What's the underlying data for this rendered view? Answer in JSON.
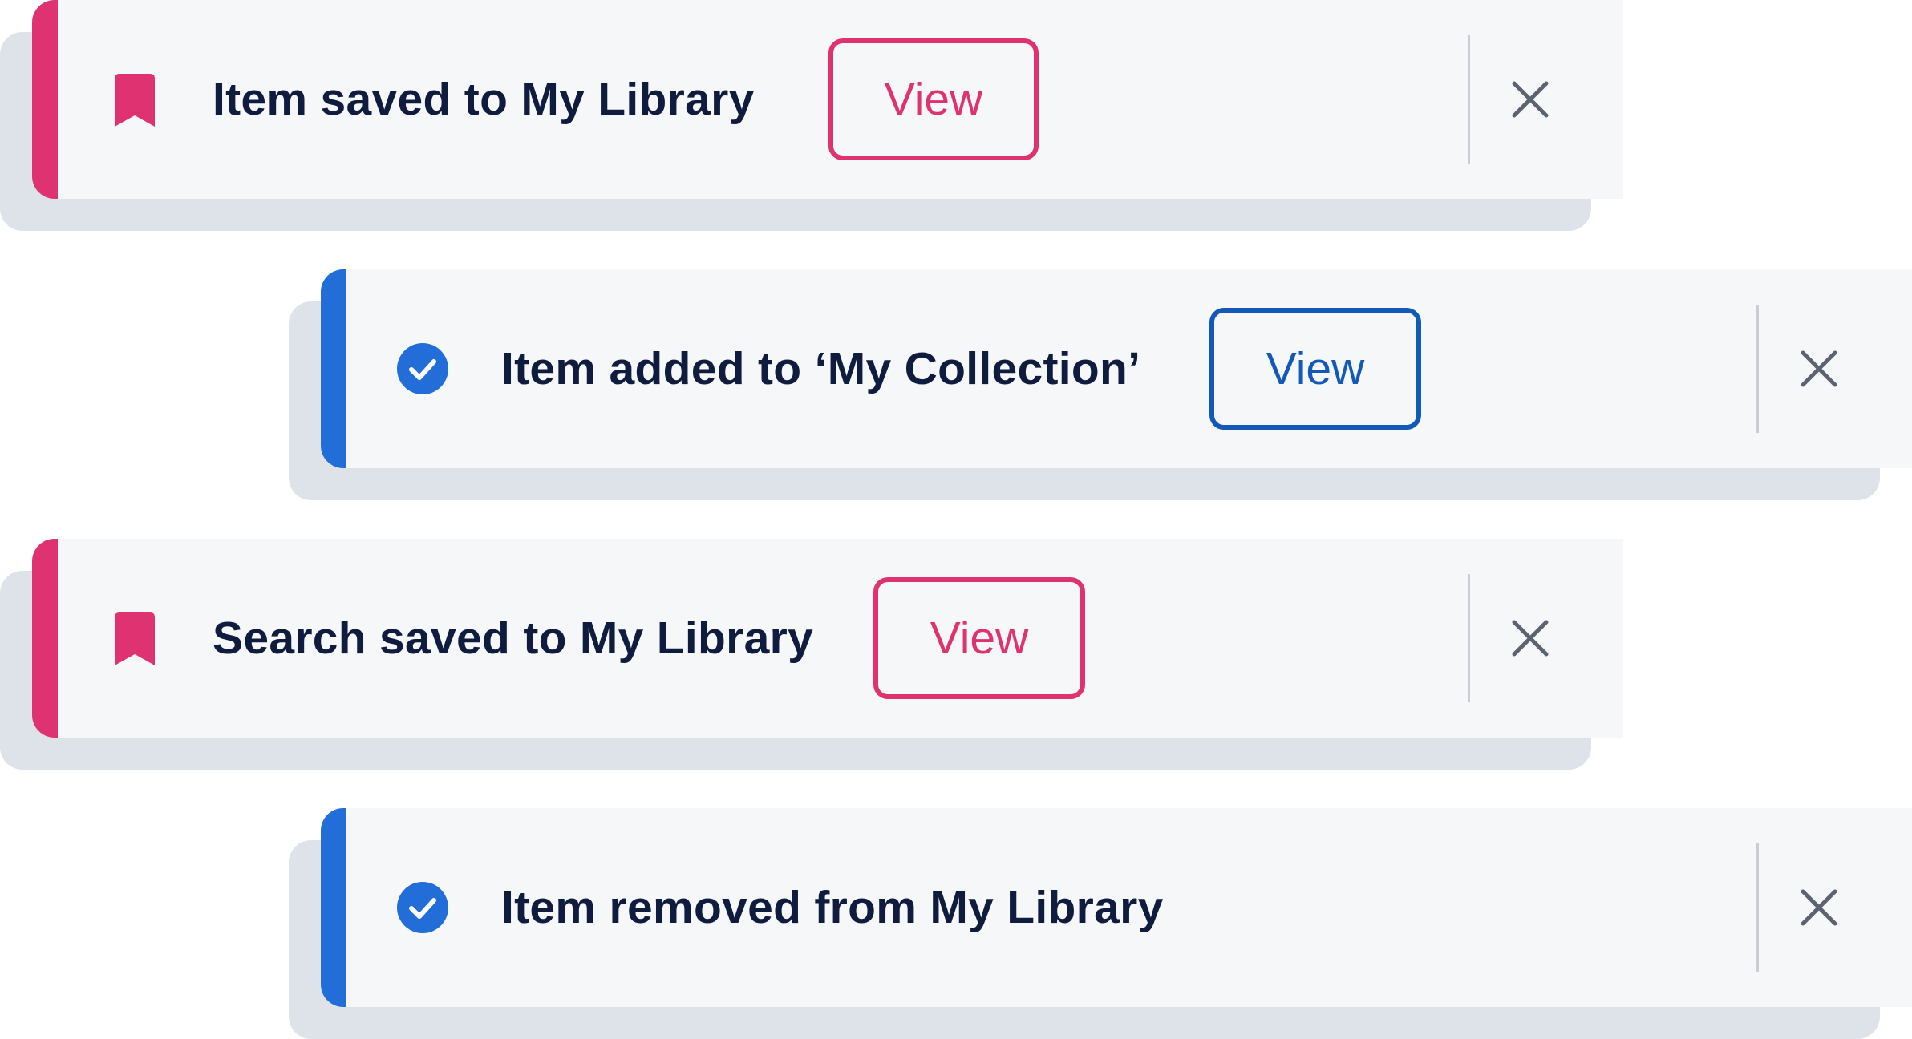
{
  "toasts": [
    {
      "message": "Item saved to My Library",
      "icon": "bookmark-icon",
      "variant": "pink",
      "action_label": "View",
      "close_icon": "close-icon"
    },
    {
      "message": "Item added to ‘My Collection’",
      "icon": "check-circle-icon",
      "variant": "blue",
      "action_label": "View",
      "close_icon": "close-icon"
    },
    {
      "message": "Search saved to My Library",
      "icon": "bookmark-icon",
      "variant": "pink",
      "action_label": "View",
      "close_icon": "close-icon"
    },
    {
      "message": "Item removed from My Library",
      "icon": "check-circle-icon",
      "variant": "blue",
      "close_icon": "close-icon"
    }
  ],
  "colors": {
    "pink_accent": "#de3370",
    "blue_accent": "#236dd8",
    "blue_button": "#1459b8",
    "text": "#0f1c3d",
    "toast_background": "#f6f7f9",
    "shadow": "#dee2e9",
    "close_icon": "#5b6270"
  }
}
